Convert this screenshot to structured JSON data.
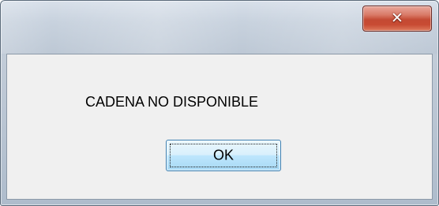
{
  "window": {
    "title": "",
    "close_icon": "close-icon",
    "close_glyph": "✕"
  },
  "dialog": {
    "message": "CADENA NO DISPONIBLE",
    "ok_label": "OK"
  },
  "colors": {
    "client_background": "#f0f0f0",
    "close_button": "#c84b33",
    "ok_button_border": "#3c7fb1"
  }
}
